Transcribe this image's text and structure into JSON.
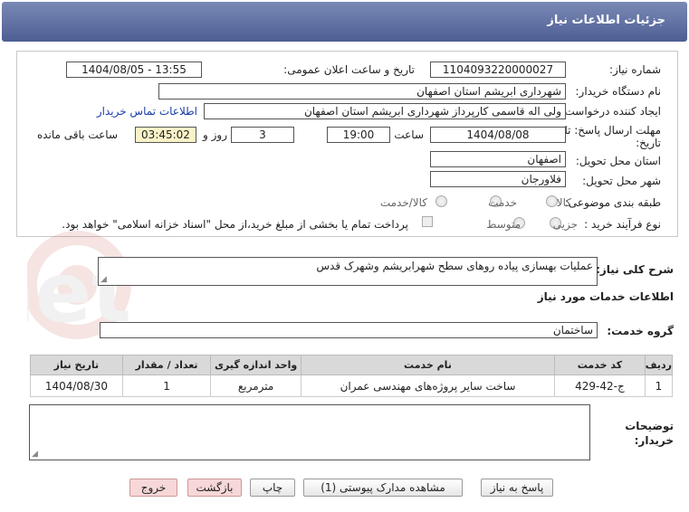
{
  "header": {
    "title": "جزئیات اطلاعات نیاز"
  },
  "form": {
    "need_number_label": "شماره نیاز:",
    "need_number": "1104093220000027",
    "announce_label": "تاریخ و ساعت اعلان عمومی:",
    "announce_value": "1404/08/05 - 13:55",
    "buyer_org_label": "نام دستگاه خریدار:",
    "buyer_org": "شهرداری ابریشم استان اصفهان",
    "creator_label": "ایجاد کننده درخواست:",
    "creator": "ولی اله قاسمی کارپرداز شهرداری ابریشم استان اصفهان",
    "contact_link": "اطلاعات تماس خریدار",
    "deadline_label_1": "مهلت ارسال پاسخ: تا",
    "deadline_label_2": "تاریخ:",
    "deadline_date": "1404/08/08",
    "time_label": "ساعت",
    "deadline_time": "19:00",
    "days": "3",
    "days_label": "روز و",
    "remaining": "03:45:02",
    "remaining_label": "ساعت باقی مانده",
    "province_label": "استان محل تحویل:",
    "province": "اصفهان",
    "city_label": "شهر محل تحویل:",
    "city": "فلاورجان",
    "category_label": "طبقه بندی موضوعی:",
    "category_options": [
      "کالا",
      "خدمت",
      "کالا/خدمت"
    ],
    "process_label": "نوع فرآیند خرید :",
    "process_options": [
      "جزیی",
      "متوسط"
    ],
    "payment_note": "پرداخت تمام یا بخشی از مبلغ خرید،از محل \"اسناد خزانه اسلامی\" خواهد بود."
  },
  "description": {
    "label": "شرح کلی نیاز:",
    "value": "عملیات بهسازی پیاده روهای سطح شهرابریشم وشهرک قدس"
  },
  "services": {
    "section_title": "اطلاعات خدمات مورد نیاز",
    "group_label": "گروه خدمت:",
    "group_value": "ساختمان",
    "columns": [
      "ردیف",
      "کد خدمت",
      "نام خدمت",
      "واحد اندازه گیری",
      "تعداد / مقدار",
      "تاریخ نیاز"
    ],
    "rows": [
      {
        "row": "1",
        "code": "ج-42-429",
        "name": "ساخت سایر پروژه‌های مهندسی عمران",
        "unit": "مترمربع",
        "qty": "1",
        "date": "1404/08/30"
      }
    ]
  },
  "notes": {
    "label_1": "توضیحات",
    "label_2": "خریدار:"
  },
  "buttons": {
    "reply": "پاسخ به نیاز",
    "attachments": "مشاهده مدارک پیوستی (1)",
    "print": "چاپ",
    "back": "بازگشت",
    "exit": "خروج"
  },
  "colors": {
    "header": "#5a6a9e",
    "pink_button": "#f7d7d7",
    "timer_bg": "#fbf3c7",
    "watermark": "#c0392b"
  }
}
